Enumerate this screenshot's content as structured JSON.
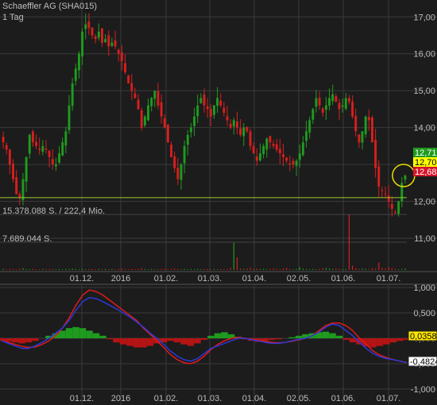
{
  "header": {
    "title": "Schaeffler AG (SHA015)",
    "interval": "1 Tag"
  },
  "colors": {
    "background": "#1c1c1c",
    "grid": "#3a3a3a",
    "text": "#bdbdbd",
    "candle_up": "#1f9b1f",
    "candle_down": "#d61f1f",
    "support_line": "#9acd32",
    "macd_line": "#2c39d8",
    "signal_line": "#e01b1b",
    "hist_pos": "#1f9b1f",
    "hist_neg": "#b51414",
    "price_tag_green": "#1f9b1f",
    "price_tag_yellow": "#ffff00",
    "price_tag_red": "#d6152a",
    "highlight_circle": "#e8e000"
  },
  "chart_data": [
    {
      "type": "candlestick",
      "ylim": [
        11.0,
        17.2
      ],
      "y_ticks": [
        "17,00",
        "16,00",
        "15,00",
        "14,00",
        "13,00",
        "12,00",
        "11,00"
      ],
      "x_ticks": [
        "01.12.",
        "2016",
        "01.02.",
        "01.03.",
        "01.04.",
        "02.05.",
        "01.06.",
        "01.07."
      ],
      "horizontal_line": 12.1,
      "price_tags": [
        "12,71",
        "12,70",
        "12,68"
      ],
      "close_series": [
        13.6,
        13.4,
        13.0,
        12.6,
        12.2,
        12.1,
        12.6,
        13.2,
        13.8,
        13.6,
        13.5,
        13.4,
        13.5,
        13.4,
        13.2,
        13.0,
        13.0,
        13.3,
        13.6,
        13.9,
        14.6,
        15.2,
        15.6,
        16.0,
        16.6,
        16.8,
        16.7,
        16.5,
        16.4,
        16.6,
        16.3,
        16.4,
        16.2,
        16.3,
        16.2,
        16.0,
        15.8,
        15.5,
        15.2,
        15.0,
        14.8,
        14.5,
        14.0,
        14.3,
        14.6,
        14.8,
        15.0,
        14.6,
        14.3,
        14.0,
        13.6,
        13.2,
        12.9,
        12.6,
        13.0,
        13.5,
        13.8,
        14.0,
        14.3,
        14.6,
        14.8,
        14.6,
        14.5,
        14.3,
        14.6,
        14.8,
        14.6,
        14.4,
        14.2,
        14.0,
        14.2,
        14.0,
        13.8,
        14.0,
        13.9,
        13.5,
        13.3,
        13.1,
        13.3,
        13.5,
        13.7,
        13.6,
        13.5,
        13.4,
        13.3,
        13.2,
        13.1,
        13.0,
        13.0,
        13.1,
        13.3,
        13.6,
        13.9,
        14.2,
        14.5,
        14.8,
        14.6,
        14.4,
        14.6,
        14.8,
        14.9,
        14.7,
        14.5,
        14.6,
        14.8,
        14.7,
        14.3,
        13.9,
        13.6,
        13.9,
        14.3,
        14.2,
        13.6,
        12.9,
        12.4,
        12.3,
        12.2,
        12.0,
        11.8,
        11.7,
        12.0,
        12.5,
        12.7
      ]
    },
    {
      "type": "bar",
      "name": "volume",
      "labels": [
        "15.378.088 S. / 222,4 Mio.",
        "7.689.044 S."
      ],
      "values": [
        0.3,
        0.2,
        0.3,
        0.3,
        0.2,
        0.3,
        0.5,
        0.3,
        0.2,
        0.3,
        0.2,
        0.2,
        0.3,
        0.2,
        0.3,
        0.3,
        0.2,
        0.3,
        0.2,
        0.3,
        0.3,
        0.4,
        0.3,
        0.2,
        0.3,
        0.2,
        0.3,
        0.3,
        0.2,
        0.3,
        0.2,
        0.3,
        0.2,
        0.3,
        0.2,
        0.3,
        0.4,
        0.3,
        0.2,
        0.3,
        0.2,
        0.3,
        0.5,
        0.3,
        0.2,
        0.3,
        0.2,
        0.2,
        0.3,
        0.3,
        0.2,
        0.3,
        0.4,
        0.3,
        0.2,
        0.3,
        0.2,
        0.3,
        0.2,
        0.3,
        0.2,
        0.3,
        0.3,
        0.2,
        0.3,
        0.2,
        0.3,
        0.2,
        0.3,
        0.6,
        7.6,
        3.5,
        0.4,
        0.3,
        0.4,
        0.6,
        0.3,
        0.4,
        0.3,
        0.3,
        0.2,
        0.3,
        0.4,
        0.3,
        0.2,
        0.4,
        0.6,
        0.3,
        0.2,
        0.3,
        0.8,
        0.4,
        0.3,
        0.2,
        0.3,
        0.2,
        0.3,
        0.5,
        0.6,
        0.4,
        0.3,
        0.4,
        0.3,
        0.2,
        0.3,
        15.4,
        1.2,
        0.5,
        0.3,
        0.4,
        0.3,
        0.2,
        0.5,
        0.4,
        2.1,
        0.6,
        0.4,
        0.8,
        0.5,
        0.3,
        0.2,
        0.3,
        0.4
      ]
    },
    {
      "type": "line",
      "name": "MACD",
      "ylim": [
        -1.0,
        1.0
      ],
      "y_ticks": [
        "1,000",
        "0,500",
        "0,000",
        "-0,500",
        "-1,000"
      ],
      "x_ticks": [
        "01.12.",
        "2016",
        "01.02.",
        "01.03.",
        "01.04.",
        "02.05.",
        "01.06.",
        "01.07."
      ],
      "value_tags": [
        "0,03580",
        "-0,4824"
      ],
      "macd": [
        -0.05,
        -0.1,
        -0.15,
        -0.2,
        -0.2,
        -0.15,
        -0.08,
        0.0,
        0.1,
        0.2,
        0.35,
        0.55,
        0.72,
        0.8,
        0.78,
        0.72,
        0.65,
        0.58,
        0.5,
        0.42,
        0.32,
        0.22,
        0.1,
        0.0,
        -0.12,
        -0.25,
        -0.35,
        -0.42,
        -0.45,
        -0.4,
        -0.3,
        -0.2,
        -0.15,
        -0.1,
        -0.05,
        0.0,
        0.0,
        -0.03,
        -0.05,
        -0.08,
        -0.1,
        -0.1,
        -0.08,
        -0.05,
        -0.02,
        0.0,
        0.05,
        0.12,
        0.22,
        0.28,
        0.25,
        0.15,
        0.05,
        -0.08,
        -0.2,
        -0.3,
        -0.36,
        -0.4,
        -0.42,
        -0.45,
        -0.48
      ],
      "signal": [
        -0.05,
        -0.08,
        -0.12,
        -0.16,
        -0.18,
        -0.17,
        -0.12,
        -0.05,
        0.05,
        0.2,
        0.4,
        0.65,
        0.85,
        0.95,
        0.92,
        0.85,
        0.75,
        0.65,
        0.55,
        0.45,
        0.35,
        0.2,
        0.08,
        -0.05,
        -0.18,
        -0.32,
        -0.42,
        -0.48,
        -0.5,
        -0.45,
        -0.35,
        -0.22,
        -0.12,
        -0.05,
        0.0,
        0.02,
        0.0,
        -0.02,
        -0.04,
        -0.06,
        -0.08,
        -0.09,
        -0.08,
        -0.06,
        -0.03,
        0.0,
        0.05,
        0.15,
        0.25,
        0.3,
        0.3,
        0.25,
        0.15,
        0.0,
        -0.12,
        -0.25,
        -0.33,
        -0.38,
        -0.42,
        -0.45,
        -0.48
      ],
      "histogram": [
        -0.05,
        -0.06,
        -0.08,
        -0.1,
        -0.08,
        -0.05,
        0.0,
        0.05,
        0.1,
        0.15,
        0.2,
        0.22,
        0.2,
        0.15,
        0.1,
        0.05,
        -0.02,
        -0.08,
        -0.12,
        -0.15,
        -0.18,
        -0.18,
        -0.15,
        -0.1,
        -0.08,
        -0.05,
        -0.08,
        -0.12,
        -0.15,
        -0.1,
        -0.03,
        0.05,
        0.1,
        0.12,
        0.08,
        0.03,
        -0.02,
        -0.05,
        -0.07,
        -0.05,
        -0.03,
        -0.02,
        0.0,
        0.02,
        0.05,
        0.08,
        0.1,
        0.12,
        0.13,
        0.1,
        0.05,
        -0.03,
        -0.08,
        -0.12,
        -0.16,
        -0.18,
        -0.15,
        -0.12,
        -0.08,
        -0.05,
        -0.03
      ]
    }
  ]
}
